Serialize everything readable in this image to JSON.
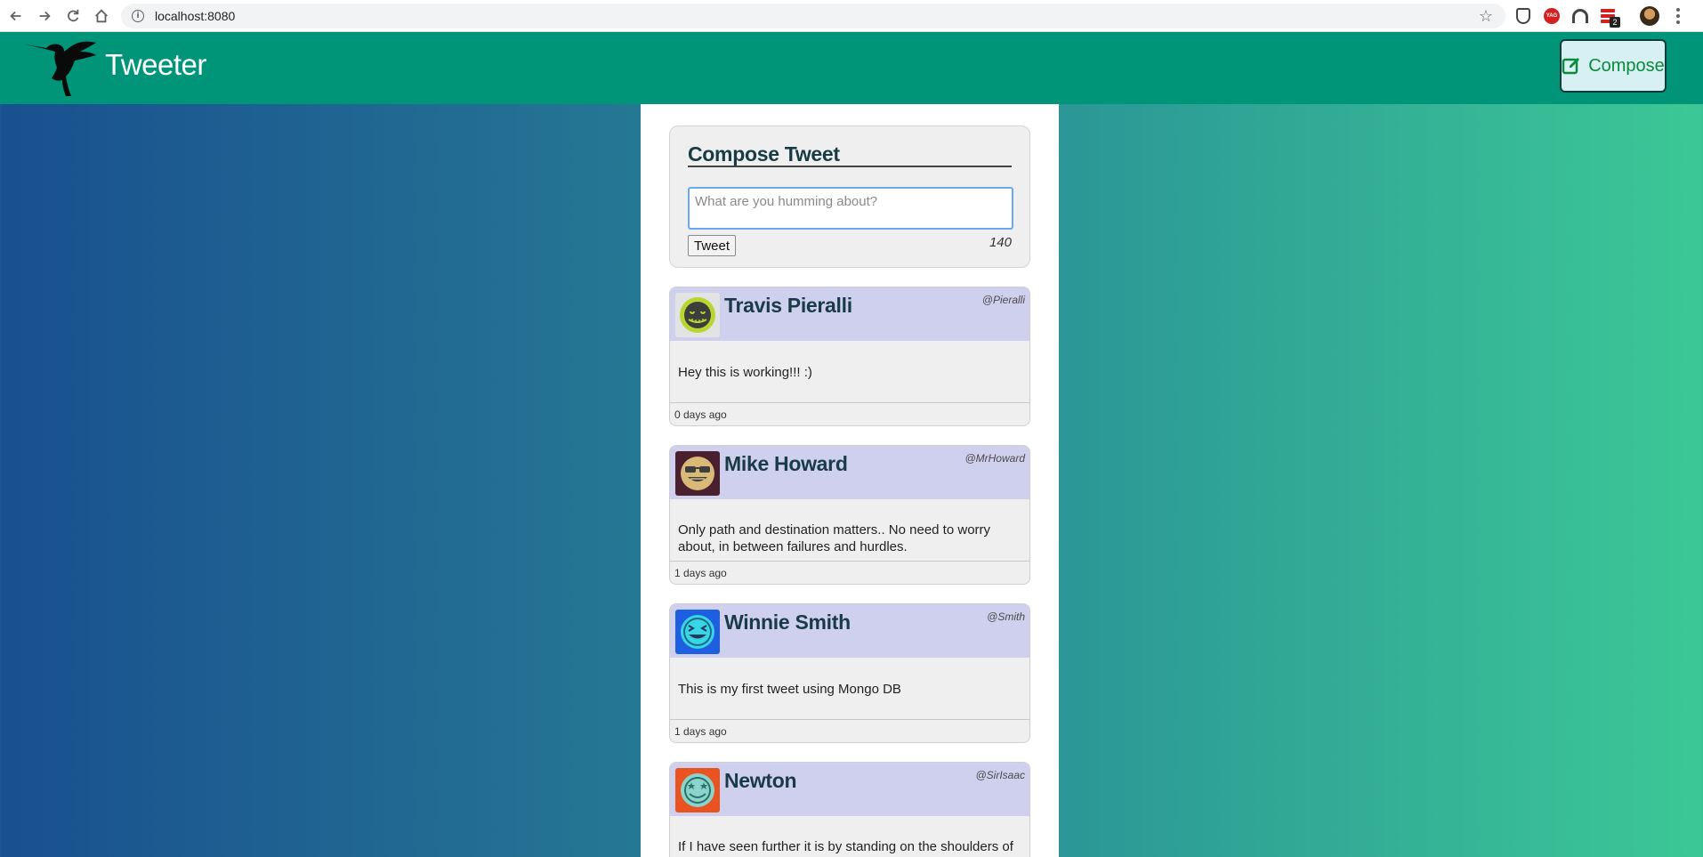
{
  "browser": {
    "url": "localhost:8080",
    "extension_badge": "2"
  },
  "header": {
    "brand": "Tweeter",
    "compose_label": "Compose"
  },
  "compose": {
    "title": "Compose Tweet",
    "placeholder": "What are you humming about?",
    "submit_label": "Tweet",
    "counter": "140"
  },
  "tweets": [
    {
      "name": "Travis Pieralli",
      "handle": "@Pieralli",
      "text": "Hey this is working!!! :)",
      "time": "0 days ago",
      "avatar": "smiley-stitched-icon",
      "avatar_color": "#e8e8e8"
    },
    {
      "name": "Mike Howard",
      "handle": "@MrHoward",
      "text": "Only path and destination matters.. No need to worry about, in between failures and hurdles.",
      "time": "1 days ago",
      "avatar": "sunglasses-grin-icon",
      "avatar_color": "#4a1f2e"
    },
    {
      "name": "Winnie Smith",
      "handle": "@Smith",
      "text": "This is my first tweet using Mongo DB",
      "time": "1 days ago",
      "avatar": "squint-grin-icon",
      "avatar_color": "#1d5fe0"
    },
    {
      "name": "Newton",
      "handle": "@SirIsaac",
      "text": "If I have seen further it is by standing on the shoulders of",
      "time": "",
      "avatar": "star-eyes-icon",
      "avatar_color": "#e8531f"
    }
  ]
}
